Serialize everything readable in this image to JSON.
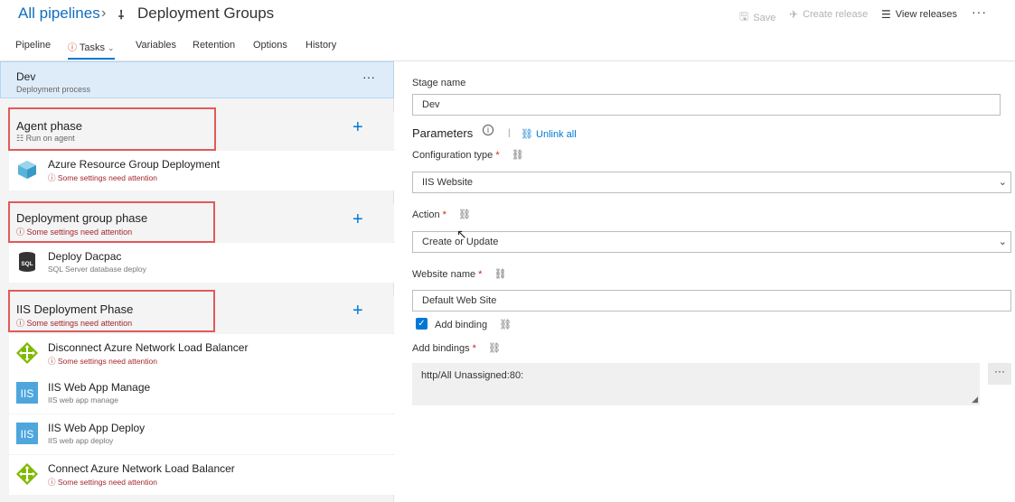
{
  "header": {
    "breadcrumb_root": "All pipelines",
    "title": "Deployment Groups",
    "toolbar": {
      "save": "Save",
      "create_release": "Create release",
      "view_releases": "View releases",
      "more": "···"
    }
  },
  "tabs": [
    {
      "label": "Pipeline"
    },
    {
      "label": "Tasks"
    },
    {
      "label": "Variables"
    },
    {
      "label": "Retention"
    },
    {
      "label": "Options"
    },
    {
      "label": "History"
    }
  ],
  "stage": {
    "name": "Dev",
    "subtitle": "Deployment process",
    "more": "···"
  },
  "phases": [
    {
      "title": "Agent phase",
      "subtitle": "Run on agent",
      "tasks": [
        {
          "name": "Azure Resource Group Deployment",
          "subtitle": "Some settings need attention",
          "icon": "azure-cube-icon"
        }
      ]
    },
    {
      "title": "Deployment group phase",
      "subtitle": "Some settings need attention",
      "tasks": [
        {
          "name": "Deploy Dacpac",
          "subtitle": "SQL Server database deploy",
          "icon": "sql-icon",
          "icon_label": "SQL"
        }
      ]
    },
    {
      "title": "IIS Deployment Phase",
      "subtitle": "Some settings need attention",
      "tasks": [
        {
          "name": "Disconnect Azure Network Load Balancer",
          "subtitle": "Some settings need attention",
          "icon": "load-balancer-icon"
        },
        {
          "name": "IIS Web App Manage",
          "subtitle": "IIS web app manage",
          "icon": "iis-icon",
          "icon_label": "IIS"
        },
        {
          "name": "IIS Web App Deploy",
          "subtitle": "IIS web app deploy",
          "icon": "iis-icon",
          "icon_label": "IIS"
        },
        {
          "name": "Connect Azure Network Load Balancer",
          "subtitle": "Some settings need attention",
          "icon": "load-balancer-icon"
        }
      ]
    }
  ],
  "form": {
    "stage_name_label": "Stage name",
    "stage_name_value": "Dev",
    "parameters_label": "Parameters",
    "unlink_all": "Unlink all",
    "config_type_label": "Configuration type",
    "config_type_value": "IIS Website",
    "action_label": "Action",
    "action_value": "Create or Update",
    "website_name_label": "Website name",
    "website_name_value": "Default Web Site",
    "add_binding_label": "Add binding",
    "add_binding_checked": true,
    "add_bindings_label": "Add bindings",
    "add_bindings_value": "http/All Unassigned:80:",
    "required_mark": "*"
  },
  "colors": {
    "accent": "#0078d4",
    "warning": "#a4262c",
    "highlight_box": "#e05a5a",
    "stage_bg": "#deecf9"
  }
}
